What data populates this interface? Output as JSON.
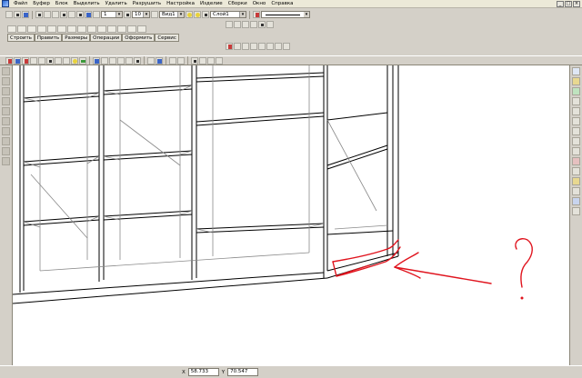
{
  "menu": {
    "items": [
      "Файл",
      "Буфер",
      "Блок",
      "Выделить",
      "Удалить",
      "Разрушить",
      "Настройка",
      "Изделие",
      "Сборки",
      "Окно",
      "Справка"
    ]
  },
  "toolbar": {
    "line_value": "1",
    "size_value": "10",
    "view_value": "Вид1",
    "layer_value": "Слой1",
    "tabs": [
      "Строить",
      "Править",
      "Размеры",
      "Операции",
      "Оформить",
      "Сервис"
    ]
  },
  "status": {
    "x_label": "X",
    "x_value": "58.733",
    "y_label": "Y",
    "y_value": "70.547"
  },
  "annotation": {
    "question_mark": "?",
    "stroke_color": "#e0141e"
  },
  "icons": {
    "app": "app-logo-icon",
    "window_min": "minimize-icon",
    "window_max": "maximize-icon",
    "window_close": "close-icon"
  }
}
